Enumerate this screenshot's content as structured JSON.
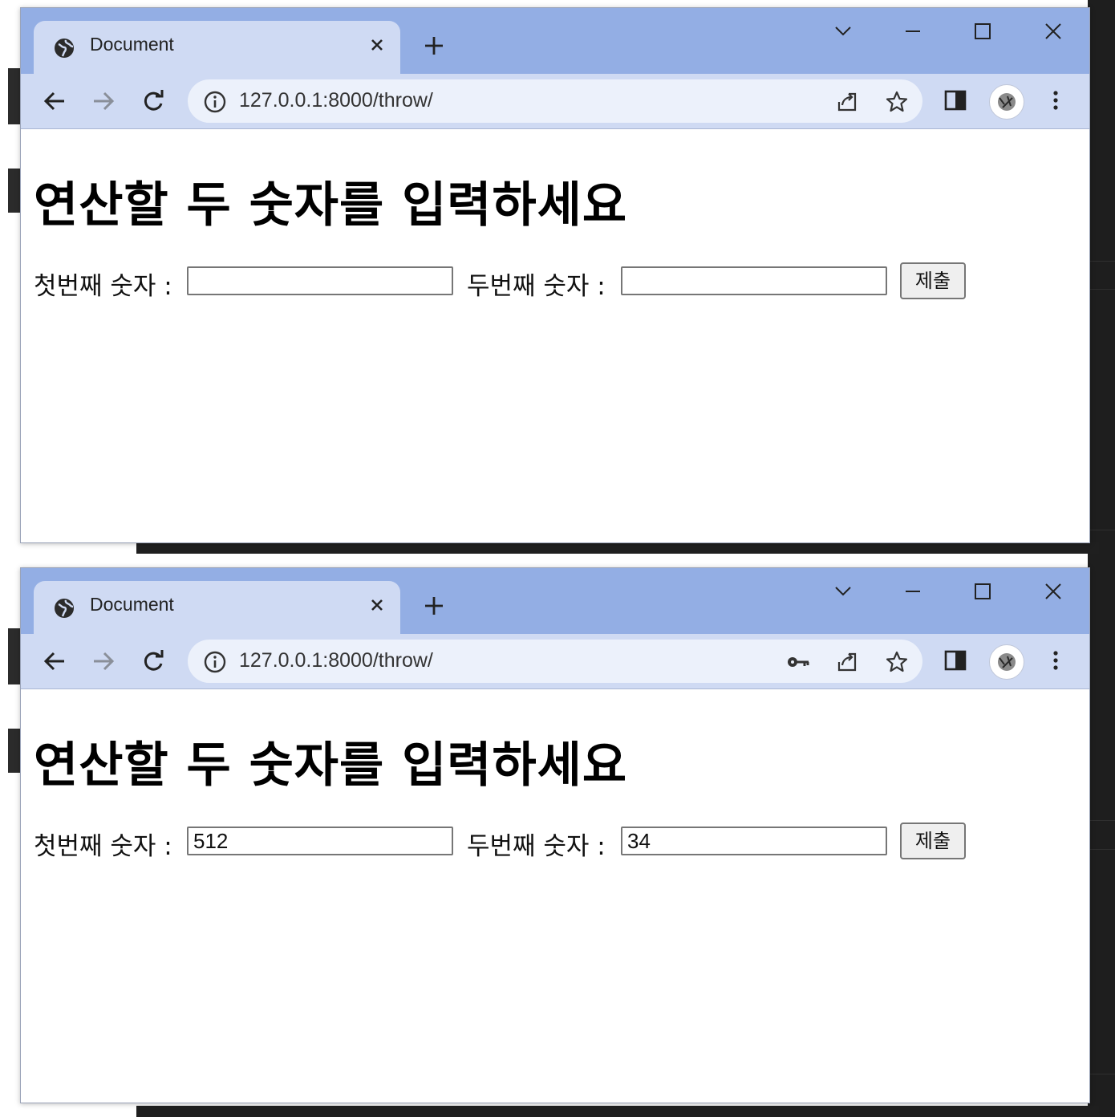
{
  "windows": [
    {
      "tab": {
        "title": "Document"
      },
      "address_bar": {
        "url": "127.0.0.1:8000/throw/",
        "show_key_icon": false
      },
      "page": {
        "heading": "연산할 두 숫자를 입력하세요",
        "first_label": "첫번째 숫자 :",
        "first_value": "",
        "second_label": "두번째 숫자 :",
        "second_value": "",
        "submit_label": "제출"
      }
    },
    {
      "tab": {
        "title": "Document"
      },
      "address_bar": {
        "url": "127.0.0.1:8000/throw/",
        "show_key_icon": true
      },
      "page": {
        "heading": "연산할 두 숫자를 입력하세요",
        "first_label": "첫번째 숫자 :",
        "first_value": "512",
        "second_label": "두번째 숫자 :",
        "second_value": "34",
        "submit_label": "제출"
      }
    }
  ],
  "colors": {
    "titlebar": "#93aee4",
    "tab_active": "#cfdaf3",
    "toolbar": "#cfdaf3",
    "omnibox": "#ecf1fb"
  },
  "icons": [
    "globe-icon",
    "close-icon",
    "plus-icon",
    "chevron-down-icon",
    "minimize-icon",
    "maximize-icon",
    "window-close-icon",
    "back-arrow-icon",
    "forward-arrow-icon",
    "reload-icon",
    "info-icon",
    "key-icon",
    "share-icon",
    "star-icon",
    "side-panel-icon",
    "avatar",
    "more-vert-icon"
  ]
}
